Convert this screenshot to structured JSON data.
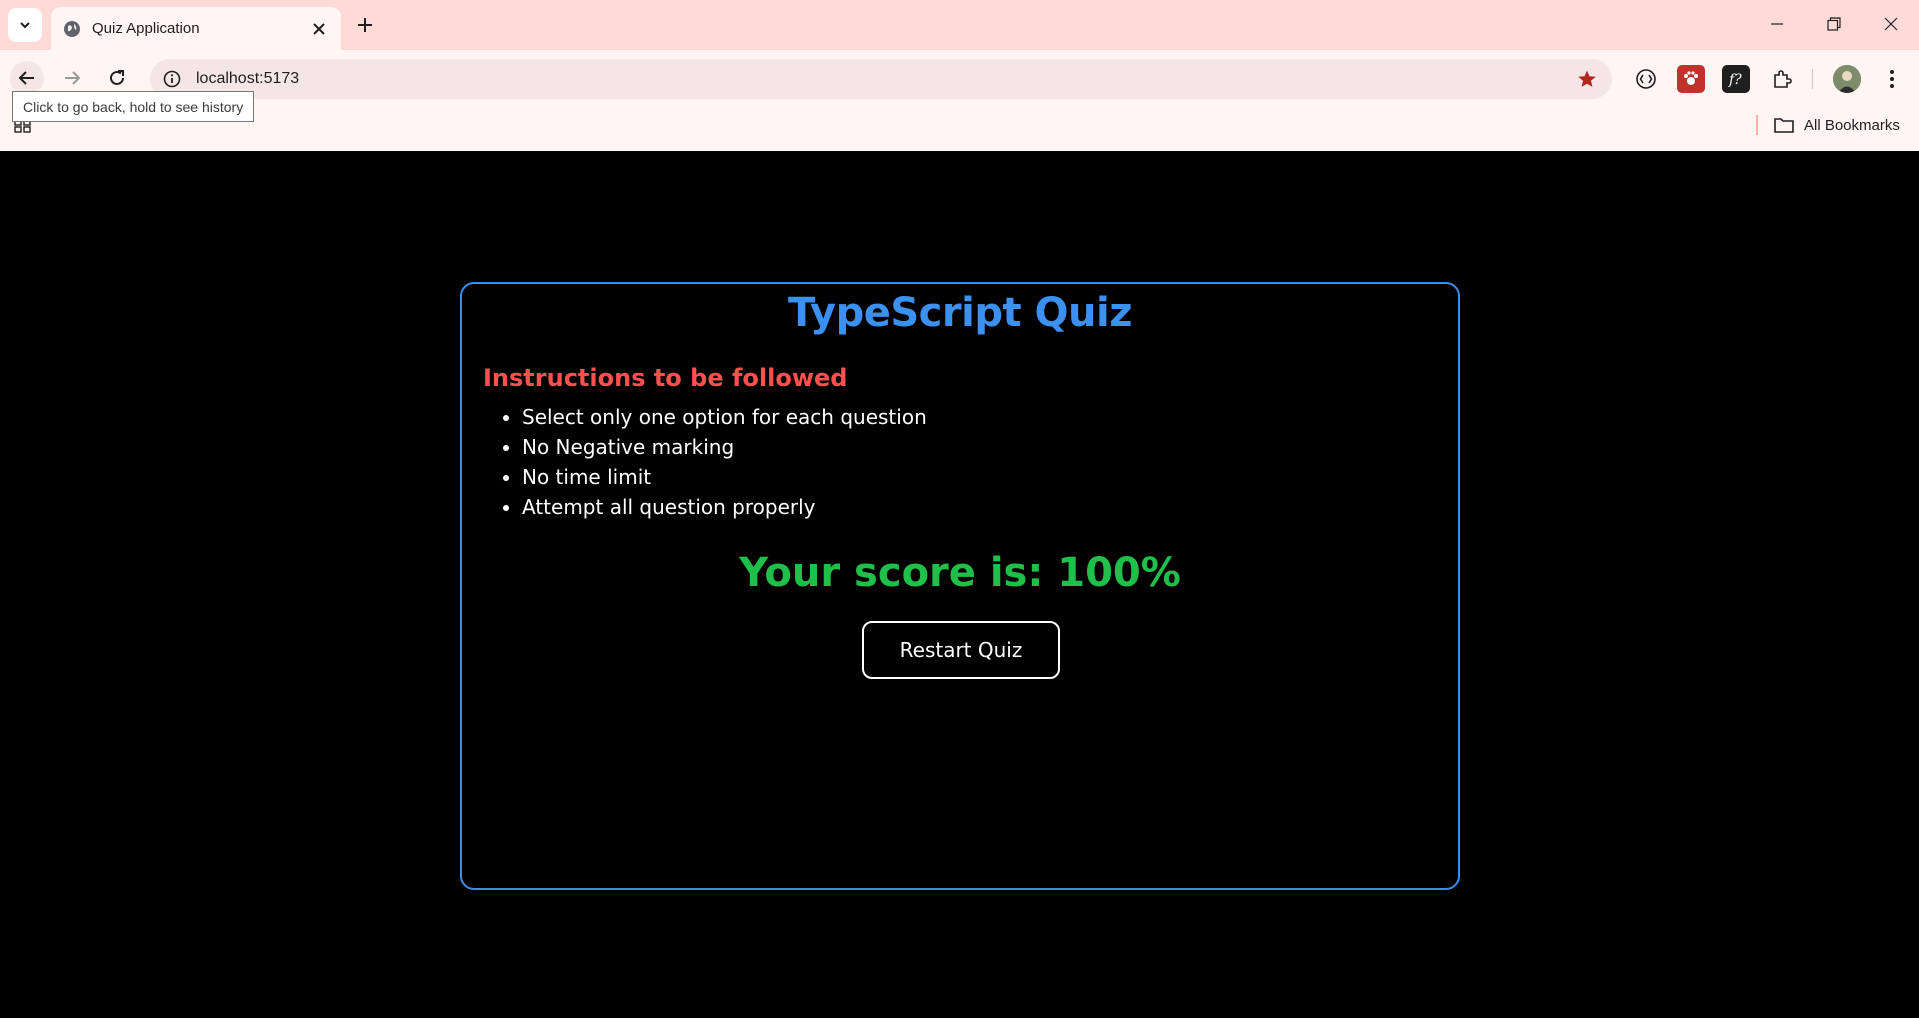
{
  "browser": {
    "tab_title": "Quiz Application",
    "url": "localhost:5173",
    "tooltip": "Click to go back, hold to see history",
    "all_bookmarks_label": "All Bookmarks",
    "colors": {
      "frame": "#ffdad6",
      "toolbar": "#fff5f3",
      "omnibox": "#f4e6e5",
      "star": "#b3261e"
    }
  },
  "page": {
    "title": "TypeScript Quiz",
    "instructions_heading": "Instructions to be followed",
    "instructions": [
      "Select only one option for each question",
      "No Negative marking",
      "No time limit",
      "Attempt all question properly"
    ],
    "score_text": "Your score is: 100%",
    "restart_label": "Restart Quiz",
    "colors": {
      "background": "#000000",
      "card_border": "#3a8eea",
      "title": "#3b90f0",
      "heading": "#ff5050",
      "score": "#1fc04a"
    }
  }
}
